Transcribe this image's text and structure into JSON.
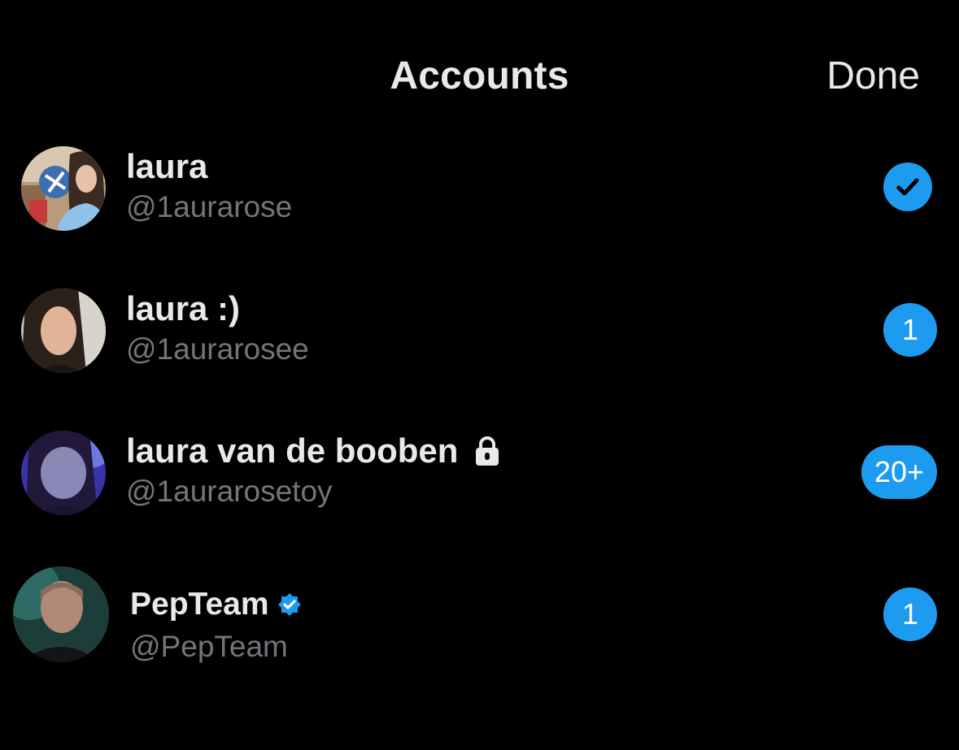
{
  "header": {
    "title": "Accounts",
    "done_label": "Done"
  },
  "accounts": [
    {
      "display_name": "laura",
      "handle": "@1aurarose",
      "status": "selected",
      "status_icon": "check-icon"
    },
    {
      "display_name": "laura :)",
      "handle": "@1aurarosee",
      "badge_count": "1"
    },
    {
      "display_name": "laura van de booben",
      "handle": "@1aurarosetoy",
      "protected_icon": "lock-icon",
      "badge_count": "20+"
    },
    {
      "display_name": "PepTeam",
      "handle": "@PepTeam",
      "verified_icon": "verified-badge-icon",
      "badge_count": "1"
    }
  ],
  "colors": {
    "background": "#000000",
    "primary_text": "#e7e9ea",
    "secondary_text": "#71767b",
    "accent": "#1d9bf0"
  }
}
